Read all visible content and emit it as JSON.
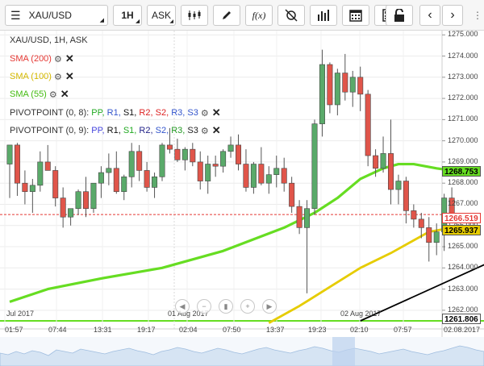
{
  "toolbar": {
    "symbol": "XAU/USD",
    "timeframe": "1H",
    "price_type": "ASK",
    "fx_label": "f(x)"
  },
  "legend": {
    "title": "XAU/USD, 1H, ASK",
    "sma200": "SMA (200)",
    "sma100": "SMA (100)",
    "sma55": "SMA (55)",
    "pivot1_prefix": "PIVOTPOINT (0, 8):",
    "pivot2_prefix": "PIVOTPOINT (0, 9):",
    "pivot_levels": [
      "PP,",
      "R1,",
      "S1,",
      "R2,",
      "S2,",
      "R3,",
      "S3"
    ]
  },
  "colors": {
    "sma200": "#e53935",
    "sma100": "#e6cc00",
    "sma55": "#66dd22",
    "pp": "#22aa22",
    "pp2": "#4444dd",
    "r1": "#3355cc",
    "s1": "#111111",
    "r2": "#dd2222",
    "s2": "#222288",
    "r3": "#229922",
    "s3": "#222222",
    "bull": "#5aaa6a",
    "bear": "#e0554a"
  },
  "price_labels": {
    "sma55": "1268.753",
    "current": "1266.519",
    "sma100": "1265.937",
    "sma200": "1261.806"
  },
  "y_ticks": [
    "1275.000",
    "1274.000",
    "1273.000",
    "1272.000",
    "1271.000",
    "1270.000",
    "1269.000",
    "1268.000",
    "1267.000",
    "1266.000",
    "1265.000",
    "1264.000",
    "1263.000",
    "1262.000"
  ],
  "x_ticks": [
    "01:57",
    "07:44",
    "13:31",
    "19:17",
    "02:04",
    "07:50",
    "13:37",
    "19:23",
    "02:10",
    "07:57",
    "02.08.2017"
  ],
  "date_marks": [
    "Jul 2017",
    "01 Aug 2017",
    "02 Aug 2017"
  ],
  "chart_data": {
    "type": "candlestick",
    "symbol": "XAU/USD",
    "interval": "1H",
    "ylim": [
      1261.5,
      1275.2
    ],
    "candles": [
      {
        "o": 1268.9,
        "h": 1269.6,
        "l": 1267.3,
        "c": 1269.8
      },
      {
        "o": 1269.8,
        "h": 1269.9,
        "l": 1267.4,
        "c": 1268.0
      },
      {
        "o": 1268.0,
        "h": 1268.6,
        "l": 1267.0,
        "c": 1267.6
      },
      {
        "o": 1267.6,
        "h": 1268.2,
        "l": 1266.6,
        "c": 1267.9
      },
      {
        "o": 1267.9,
        "h": 1269.5,
        "l": 1267.6,
        "c": 1269.0
      },
      {
        "o": 1269.0,
        "h": 1269.8,
        "l": 1268.8,
        "c": 1268.6
      },
      {
        "o": 1268.6,
        "h": 1268.8,
        "l": 1266.9,
        "c": 1267.3
      },
      {
        "o": 1267.3,
        "h": 1267.8,
        "l": 1265.9,
        "c": 1266.4
      },
      {
        "o": 1266.4,
        "h": 1266.8,
        "l": 1266.0,
        "c": 1266.8
      },
      {
        "o": 1266.8,
        "h": 1267.7,
        "l": 1266.5,
        "c": 1267.6
      },
      {
        "o": 1267.6,
        "h": 1268.3,
        "l": 1266.4,
        "c": 1266.8
      },
      {
        "o": 1266.8,
        "h": 1268.0,
        "l": 1266.6,
        "c": 1268.0
      },
      {
        "o": 1268.0,
        "h": 1268.8,
        "l": 1267.3,
        "c": 1268.5
      },
      {
        "o": 1268.5,
        "h": 1269.4,
        "l": 1267.9,
        "c": 1268.7
      },
      {
        "o": 1268.7,
        "h": 1269.5,
        "l": 1267.5,
        "c": 1267.6
      },
      {
        "o": 1267.6,
        "h": 1268.4,
        "l": 1267.2,
        "c": 1268.3
      },
      {
        "o": 1268.3,
        "h": 1269.9,
        "l": 1267.8,
        "c": 1269.5
      },
      {
        "o": 1269.5,
        "h": 1269.8,
        "l": 1268.1,
        "c": 1268.6
      },
      {
        "o": 1268.6,
        "h": 1269.0,
        "l": 1267.6,
        "c": 1267.8
      },
      {
        "o": 1267.8,
        "h": 1268.5,
        "l": 1267.3,
        "c": 1268.3
      },
      {
        "o": 1268.3,
        "h": 1269.9,
        "l": 1268.1,
        "c": 1269.8
      },
      {
        "o": 1269.8,
        "h": 1270.6,
        "l": 1269.4,
        "c": 1269.6
      },
      {
        "o": 1269.6,
        "h": 1270.1,
        "l": 1269.0,
        "c": 1269.1
      },
      {
        "o": 1269.1,
        "h": 1269.7,
        "l": 1268.6,
        "c": 1269.6
      },
      {
        "o": 1269.6,
        "h": 1269.9,
        "l": 1268.8,
        "c": 1269.0
      },
      {
        "o": 1269.0,
        "h": 1269.5,
        "l": 1267.7,
        "c": 1268.1
      },
      {
        "o": 1268.1,
        "h": 1269.3,
        "l": 1267.5,
        "c": 1268.9
      },
      {
        "o": 1268.9,
        "h": 1269.3,
        "l": 1268.3,
        "c": 1268.8
      },
      {
        "o": 1268.8,
        "h": 1269.6,
        "l": 1268.5,
        "c": 1269.5
      },
      {
        "o": 1269.5,
        "h": 1270.2,
        "l": 1269.2,
        "c": 1269.8
      },
      {
        "o": 1269.8,
        "h": 1270.3,
        "l": 1268.6,
        "c": 1268.9
      },
      {
        "o": 1268.9,
        "h": 1269.6,
        "l": 1267.6,
        "c": 1267.8
      },
      {
        "o": 1267.8,
        "h": 1269.0,
        "l": 1267.5,
        "c": 1268.9
      },
      {
        "o": 1268.9,
        "h": 1269.7,
        "l": 1267.9,
        "c": 1268.0
      },
      {
        "o": 1268.0,
        "h": 1268.8,
        "l": 1267.5,
        "c": 1268.4
      },
      {
        "o": 1268.4,
        "h": 1269.3,
        "l": 1267.8,
        "c": 1268.7
      },
      {
        "o": 1268.7,
        "h": 1269.2,
        "l": 1267.6,
        "c": 1268.0
      },
      {
        "o": 1268.0,
        "h": 1268.3,
        "l": 1266.6,
        "c": 1266.9
      },
      {
        "o": 1266.9,
        "h": 1267.2,
        "l": 1265.6,
        "c": 1265.9
      },
      {
        "o": 1265.9,
        "h": 1267.2,
        "l": 1262.8,
        "c": 1266.8
      },
      {
        "o": 1266.8,
        "h": 1271.0,
        "l": 1266.5,
        "c": 1270.8
      },
      {
        "o": 1270.8,
        "h": 1274.3,
        "l": 1270.2,
        "c": 1273.6
      },
      {
        "o": 1273.6,
        "h": 1273.7,
        "l": 1271.3,
        "c": 1271.7
      },
      {
        "o": 1271.7,
        "h": 1273.4,
        "l": 1271.2,
        "c": 1273.2
      },
      {
        "o": 1273.2,
        "h": 1274.1,
        "l": 1271.9,
        "c": 1272.3
      },
      {
        "o": 1272.3,
        "h": 1273.3,
        "l": 1271.6,
        "c": 1273.0
      },
      {
        "o": 1273.0,
        "h": 1273.5,
        "l": 1271.4,
        "c": 1272.2
      },
      {
        "o": 1272.2,
        "h": 1272.4,
        "l": 1268.8,
        "c": 1269.3
      },
      {
        "o": 1269.3,
        "h": 1269.6,
        "l": 1268.3,
        "c": 1268.7
      },
      {
        "o": 1268.7,
        "h": 1270.2,
        "l": 1268.5,
        "c": 1269.4
      },
      {
        "o": 1269.4,
        "h": 1271.0,
        "l": 1267.0,
        "c": 1267.7
      },
      {
        "o": 1267.7,
        "h": 1268.4,
        "l": 1267.0,
        "c": 1268.1
      },
      {
        "o": 1268.1,
        "h": 1268.3,
        "l": 1266.1,
        "c": 1266.7
      },
      {
        "o": 1266.7,
        "h": 1267.0,
        "l": 1265.9,
        "c": 1266.3
      },
      {
        "o": 1266.3,
        "h": 1266.6,
        "l": 1265.4,
        "c": 1265.9
      },
      {
        "o": 1265.9,
        "h": 1266.4,
        "l": 1264.3,
        "c": 1265.2
      },
      {
        "o": 1265.2,
        "h": 1266.1,
        "l": 1264.6,
        "c": 1265.7
      },
      {
        "o": 1265.7,
        "h": 1267.5,
        "l": 1264.8,
        "c": 1267.3
      },
      {
        "o": 1267.3,
        "h": 1267.8,
        "l": 1266.1,
        "c": 1266.5
      }
    ],
    "sma55": [
      [
        0,
        1262.4
      ],
      [
        5,
        1263.0
      ],
      [
        12,
        1263.5
      ],
      [
        20,
        1264.0
      ],
      [
        28,
        1264.8
      ],
      [
        36,
        1265.9
      ],
      [
        40,
        1266.6
      ],
      [
        43,
        1267.3
      ],
      [
        46,
        1268.2
      ],
      [
        49,
        1268.7
      ],
      [
        51,
        1268.9
      ],
      [
        53,
        1268.9
      ],
      [
        56,
        1268.7
      ],
      [
        58,
        1268.6
      ]
    ],
    "sma100": [
      [
        34,
        1261.4
      ],
      [
        38,
        1262.2
      ],
      [
        42,
        1263.1
      ],
      [
        46,
        1264.0
      ],
      [
        50,
        1264.7
      ],
      [
        53,
        1265.3
      ],
      [
        55,
        1265.7
      ],
      [
        58,
        1265.9
      ]
    ],
    "trendline": [
      [
        46,
        1261.5
      ],
      [
        65,
        1264.6
      ]
    ],
    "current_price": 1266.519
  }
}
